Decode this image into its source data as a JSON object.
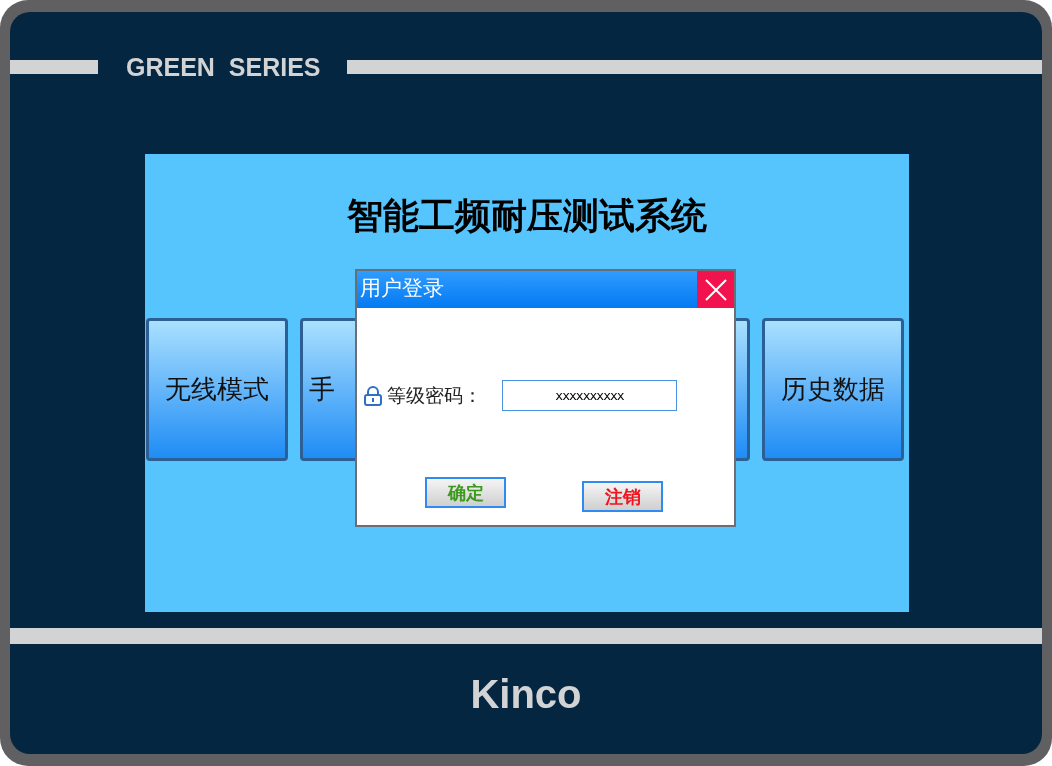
{
  "device": {
    "series": "GREEN  SERIES",
    "brand": "Kinco"
  },
  "screen": {
    "title": "智能工频耐压测试系统",
    "menu_left": [
      {
        "kind": "labeled",
        "label": "无线模式"
      },
      {
        "kind": "labeled",
        "label": "手"
      }
    ],
    "menu_right": [
      {
        "kind": "covered"
      },
      {
        "kind": "labeled",
        "label": "历史数据"
      }
    ]
  },
  "dialog": {
    "title": "用户登录",
    "field_label": "等级密码：",
    "field_value": "xxxxxxxxxx",
    "buttons": [
      {
        "label": "确定",
        "kind": "confirm"
      },
      {
        "label": "注销",
        "kind": "cancel"
      }
    ]
  }
}
